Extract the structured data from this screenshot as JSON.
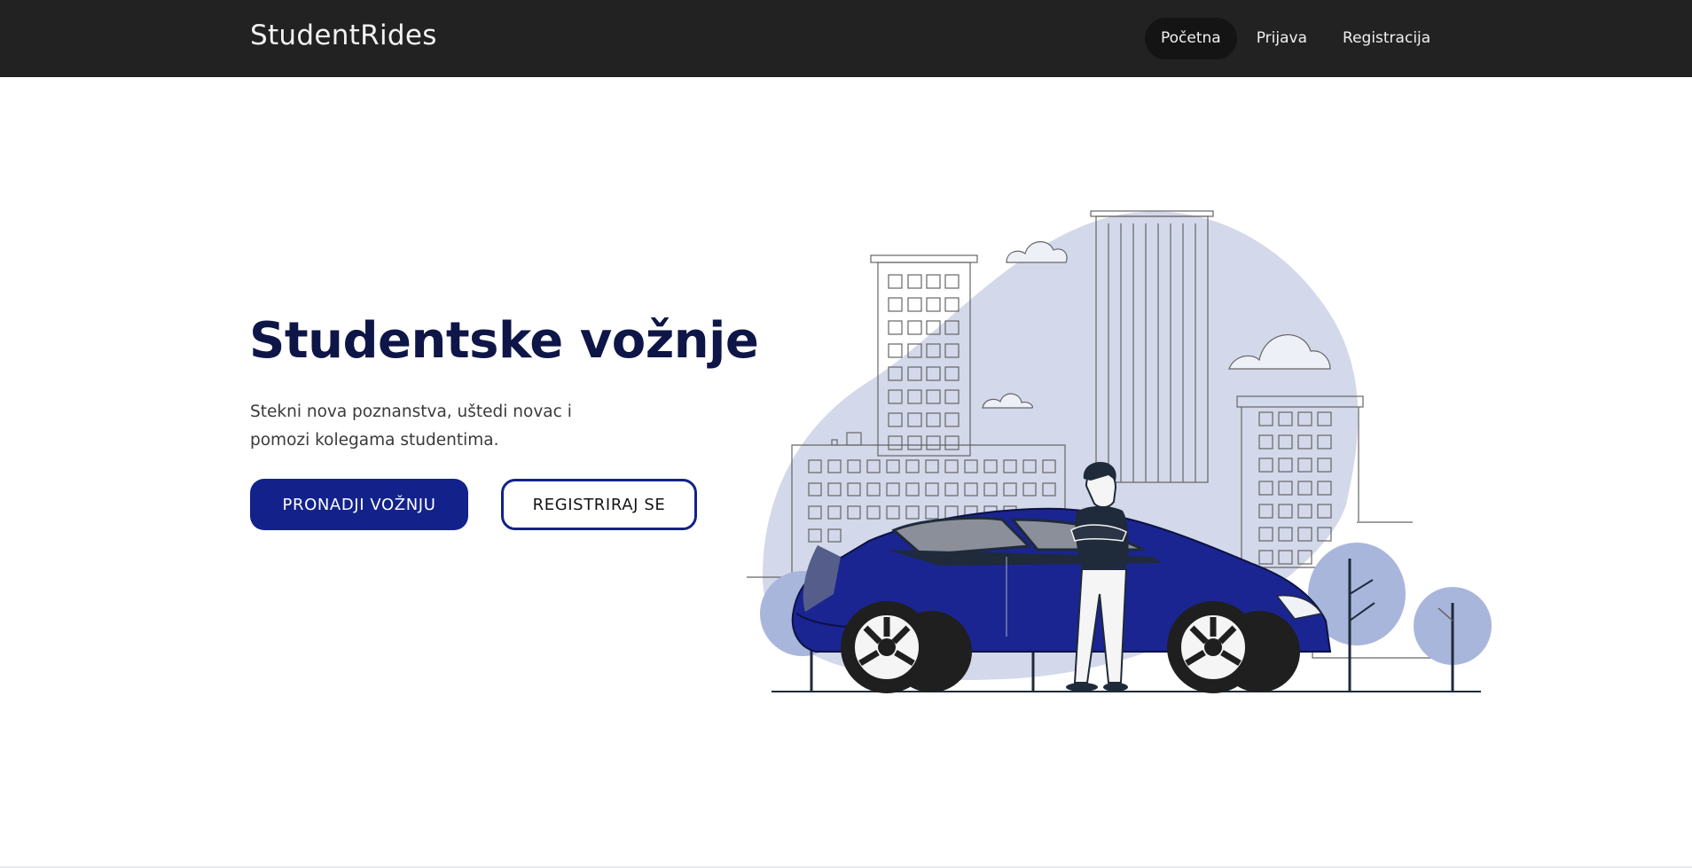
{
  "navbar": {
    "brand": "StudentRides",
    "links": [
      {
        "label": "Početna",
        "active": true
      },
      {
        "label": "Prijava",
        "active": false
      },
      {
        "label": "Registracija",
        "active": false
      }
    ]
  },
  "hero": {
    "title": "Studentske vožnje",
    "subtitle": "Stekni nova poznanstva, uštedi novac i pomozi kolegama studentima.",
    "primary_button": "PRONADJI VOŽNJU",
    "secondary_button": "REGISTRIRAJ SE"
  },
  "colors": {
    "navbar_bg": "#222222",
    "accent": "#13228a",
    "title": "#0e1547",
    "blob": "#d3d8ea",
    "car": "#1a2592"
  },
  "illustration": {
    "icon": "city-car-person-illustration"
  }
}
